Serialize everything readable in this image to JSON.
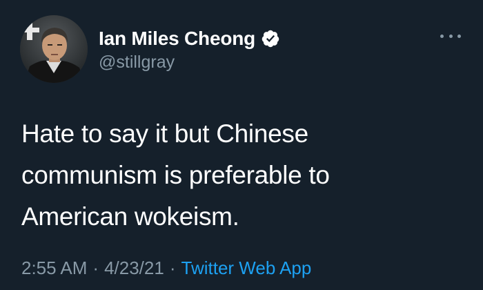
{
  "tweet": {
    "author": {
      "display_name": "Ian Miles Cheong",
      "handle": "@stillgray",
      "verified": true
    },
    "text_lines": [
      "Hate to say it but Chinese",
      "communism is preferable to",
      "American wokeism."
    ],
    "time": "2:55 AM",
    "date": "4/23/21",
    "separator": "·",
    "source": "Twitter Web App"
  },
  "theme": {
    "background": "#15202b",
    "primary_text": "#ffffff",
    "secondary_text": "#8899a6",
    "accent": "#1da1f2"
  },
  "icons": {
    "verified": "verified-badge-icon",
    "more": "more-options-icon"
  }
}
